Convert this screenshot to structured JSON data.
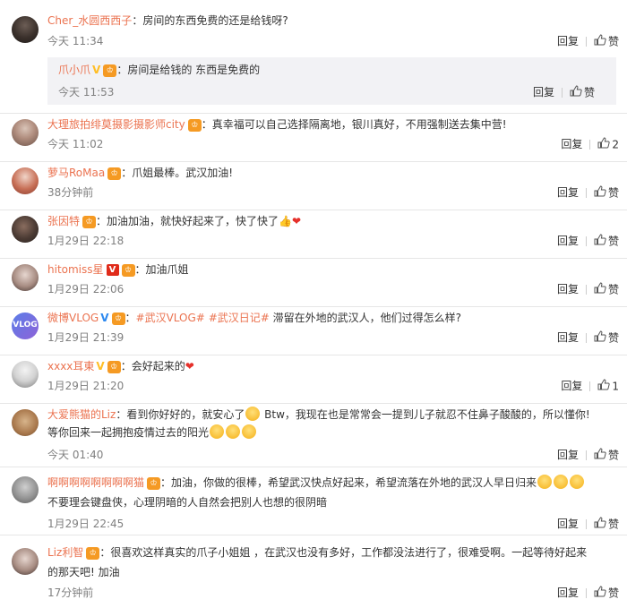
{
  "comments": [
    {
      "user": "Cher_水圆西西子",
      "colon": "：",
      "text": "房间的东西免费的还是给钱呀?",
      "time": "今天 11:34",
      "reply": "回复",
      "like": "赞",
      "sub": {
        "user": "爪小爪",
        "colon": "：",
        "text": "房间是给钱的 东西是免费的",
        "time": "今天 11:53",
        "reply": "回复",
        "like": "赞"
      }
    },
    {
      "user": "大理旅拍绯莫摄影摄影师city",
      "colon": "：",
      "text": "真幸福可以自己选择隔离地，银川真好，不用强制送去集中营!",
      "time": "今天 11:02",
      "reply": "回复",
      "like": "2"
    },
    {
      "user": "萝马RoMaa",
      "colon": "：",
      "text": "爪姐最棒。武汉加油!",
      "time": "38分钟前",
      "reply": "回复",
      "like": "赞"
    },
    {
      "user": "张因特",
      "colon": "：",
      "text": "加油加油，就快好起来了，快了快了",
      "time": "1月29日 22:18",
      "reply": "回复",
      "like": "赞"
    },
    {
      "user": "hitomiss星",
      "colon": "：",
      "text": "加油爪姐",
      "time": "1月29日 22:06",
      "reply": "回复",
      "like": "赞"
    },
    {
      "user": "微博VLOG",
      "colon": "：",
      "tag1": "#武汉VLOG#",
      "tag2": "#武汉日记#",
      "text": " 滞留在外地的武汉人，他们过得怎么样?",
      "time": "1月29日 21:39",
      "reply": "回复",
      "like": "赞",
      "avatar_text": "VLOG"
    },
    {
      "user": "xxxx耳東",
      "colon": "：",
      "text": "会好起来的",
      "time": "1月29日 21:20",
      "reply": "回复",
      "like": "1"
    },
    {
      "user": "大爱熊猫的Liz",
      "colon": "：",
      "text": "看到你好好的，就安心了",
      "text_b": " Btw，我现在也是常常会一提到儿子就忍不住鼻子酸酸的，所以懂你!",
      "text2": "等你回来一起拥抱疫情过去的阳光",
      "time": "今天 01:40",
      "reply": "回复",
      "like": "赞"
    },
    {
      "user": "啊啊啊啊啊啊啊啊猫",
      "colon": "：",
      "text": "加油，你做的很棒，希望武汉快点好起来，希望流落在外地的武汉人早日归来",
      "text2": "不要理会键盘侠，心理阴暗的人自然会把别人也想的很阴暗",
      "time": "1月29日 22:45",
      "reply": "回复",
      "like": "赞"
    },
    {
      "user": "Liz利智",
      "colon": "：",
      "text": "很喜欢这样真实的爪子小姐姐 ，在武汉也没有多好，工作都没法进行了，很难受啊。一起等待好起来",
      "text2": "的那天吧! 加油",
      "time": "17分钟前",
      "reply": "回复",
      "like": "赞"
    }
  ],
  "icons": {
    "like": "thumbs-up-icon",
    "verified_gold": "V",
    "verified_blue": "V",
    "verified_red": "V"
  },
  "colors": {
    "username": "#eb7350",
    "time": "#808080",
    "sub_bg": "#f2f2f5"
  }
}
